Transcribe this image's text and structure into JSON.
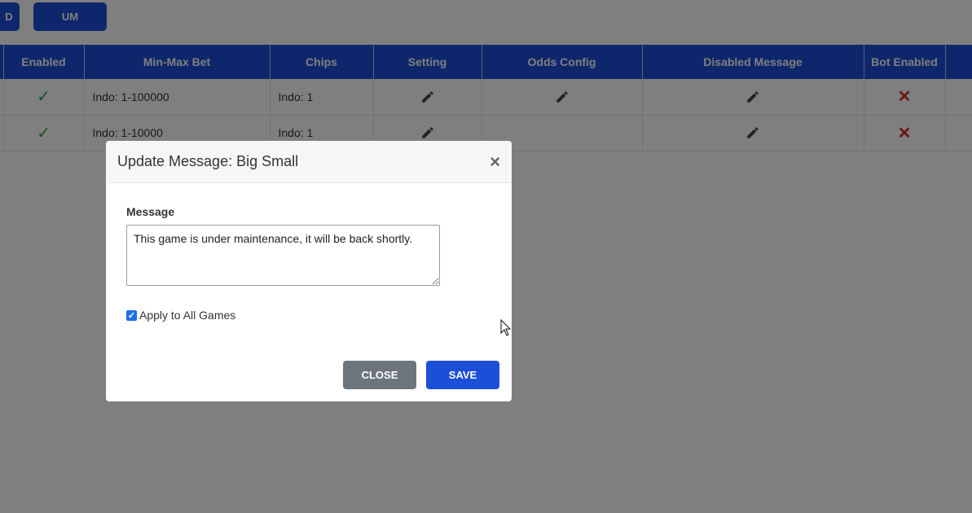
{
  "top_buttons": {
    "left_label": "D",
    "um_label": "UM"
  },
  "table": {
    "headers": [
      "",
      "Enabled",
      "Min-Max Bet",
      "Chips",
      "Setting",
      "Odds Config",
      "Disabled Message",
      "Bot Enabled",
      ""
    ],
    "rows": [
      {
        "min_max_bet": "Indo: 1-100000",
        "chips": "Indo: 1"
      },
      {
        "min_max_bet": "Indo: 1-10000",
        "chips": "Indo: 1"
      }
    ],
    "icons": {
      "enabled": "check-icon",
      "edit": "pencil-icon",
      "bot_disabled": "cross-icon"
    }
  },
  "modal": {
    "title": "Update Message: Big Small",
    "message_label": "Message",
    "message_value": "This game is under maintenance, it will be back shortly.",
    "apply_all_label": "Apply to All Games",
    "apply_all_checked": true,
    "close_label": "CLOSE",
    "save_label": "SAVE"
  },
  "colors": {
    "primary": "#1c4fd8",
    "secondary": "#6c757d",
    "success": "#2ea043",
    "danger": "#d62828"
  }
}
